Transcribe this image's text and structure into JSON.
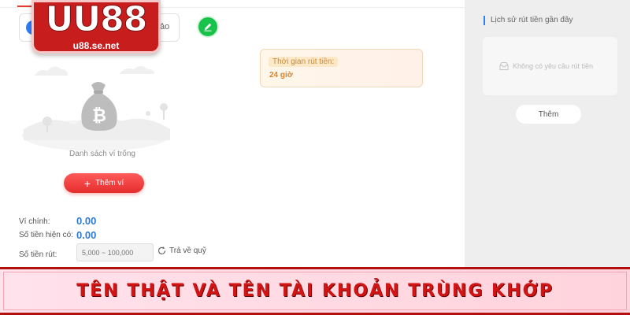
{
  "logo": {
    "text": "UU88",
    "url": "u88.se.net"
  },
  "tab": {
    "suffix": "ảo"
  },
  "withdrawal_time": {
    "label": "Thời gian rút tiền:",
    "value": "24 giờ"
  },
  "wallet": {
    "empty_text": "Danh sách ví trống",
    "add_button": "Thêm ví"
  },
  "balances": {
    "main_wallet_label": "Ví chính:",
    "main_wallet_value": "0.00",
    "available_label": "Số tiền hiện có:",
    "available_value": "0.00",
    "withdraw_label": "Số tiền rút:",
    "withdraw_placeholder": "5,000 ~ 100,000",
    "refund_label": "Trả về quỹ"
  },
  "sidebar": {
    "title": "Lịch sử rút tiền gần đây",
    "empty_text": "Không có yêu cầu rút tiền",
    "more_button": "Thêm"
  },
  "banner": {
    "text": "TÊN THẬT VÀ TÊN TÀI KHOẢN TRÙNG KHỚP"
  },
  "colors": {
    "brand_red": "#c81d1d",
    "value_blue": "#2c7ad6",
    "accent_orange": "#d8832b",
    "banner_text": "#d21414"
  },
  "icons": [
    "edit-icon",
    "bitcoin-bag-icon",
    "plus-icon",
    "refresh-icon",
    "inbox-icon"
  ]
}
